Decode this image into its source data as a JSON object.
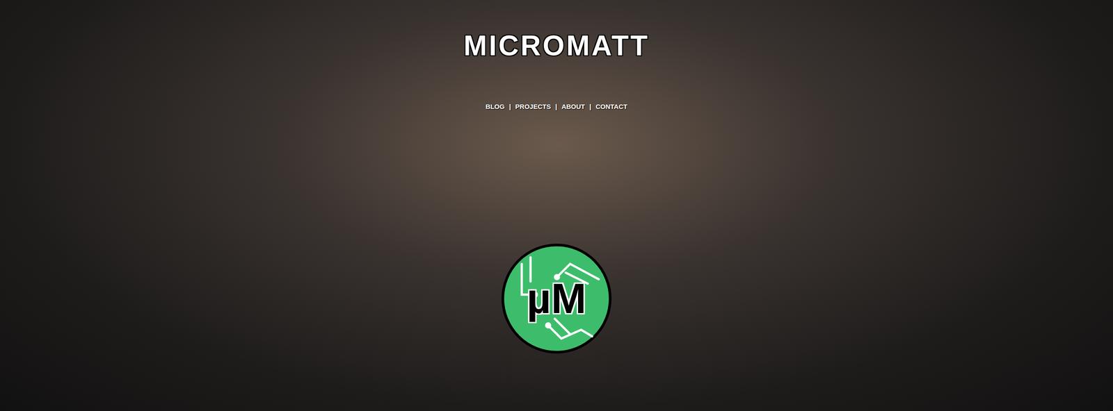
{
  "site": {
    "title": "MICROMATT"
  },
  "nav": [
    {
      "label": "BLOG"
    },
    {
      "label": "PROJECTS"
    },
    {
      "label": "ABOUT"
    },
    {
      "label": "CONTACT"
    }
  ],
  "separator": "|",
  "logo": {
    "text": "µM"
  }
}
